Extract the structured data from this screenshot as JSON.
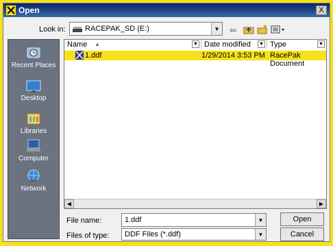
{
  "window": {
    "title": "Open",
    "close_label": "X"
  },
  "lookin": {
    "label": "Look in:",
    "value": "RACEPAK_SD (E:)"
  },
  "toolbar": {
    "back_icon": "back-arrow-icon",
    "up_icon": "up-folder-icon",
    "new_icon": "new-folder-icon",
    "view_icon": "view-menu-icon"
  },
  "places": [
    {
      "label": "Recent Places",
      "icon": "recent-places-icon"
    },
    {
      "label": "Desktop",
      "icon": "desktop-icon"
    },
    {
      "label": "Libraries",
      "icon": "libraries-icon"
    },
    {
      "label": "Computer",
      "icon": "computer-icon"
    },
    {
      "label": "Network",
      "icon": "network-icon"
    }
  ],
  "filelist": {
    "columns": [
      "Name",
      "Date modified",
      "Type"
    ],
    "rows": [
      {
        "name": "1.ddf",
        "date": "1/29/2014 3:53 PM",
        "type": "RacePak Document"
      }
    ]
  },
  "filename": {
    "label": "File name:",
    "value": "1.ddf"
  },
  "filetype": {
    "label": "Files of type:",
    "value": "DDF Files (*.ddf)"
  },
  "buttons": {
    "open": "Open",
    "cancel": "Cancel"
  },
  "colors": {
    "highlight": "#f7e11a",
    "titlebar": "#0a246a",
    "places_bg": "#6b7280"
  }
}
